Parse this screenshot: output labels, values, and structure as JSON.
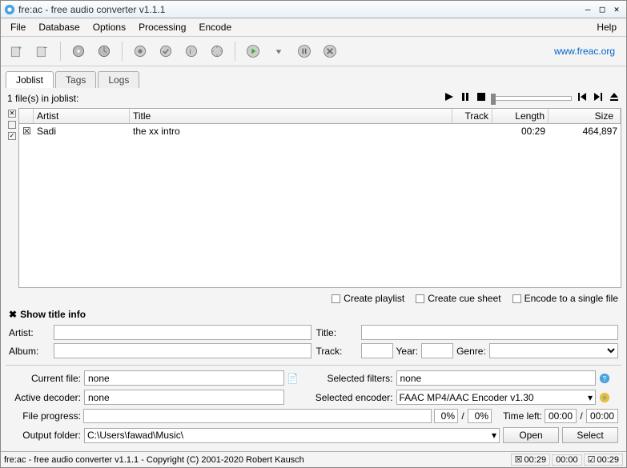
{
  "window": {
    "title": "fre:ac - free audio converter v1.1.1"
  },
  "menu": {
    "file": "File",
    "database": "Database",
    "options": "Options",
    "processing": "Processing",
    "encode": "Encode",
    "help": "Help"
  },
  "website": "www.freac.org",
  "tabs": {
    "joblist": "Joblist",
    "tags": "Tags",
    "logs": "Logs"
  },
  "joblist": {
    "count_label": "1 file(s) in joblist:",
    "columns": {
      "artist": "Artist",
      "title": "Title",
      "track": "Track",
      "length": "Length",
      "size": "Size"
    },
    "rows": [
      {
        "artist": "Sadi",
        "title": "the xx intro",
        "track": "",
        "length": "00:29",
        "size": "464,897"
      }
    ]
  },
  "options": {
    "create_playlist": "Create playlist",
    "create_cuesheet": "Create cue sheet",
    "encode_single": "Encode to a single file"
  },
  "titleinfo": {
    "toggle": "Show title info",
    "artist_lbl": "Artist:",
    "title_lbl": "Title:",
    "album_lbl": "Album:",
    "track_lbl": "Track:",
    "year_lbl": "Year:",
    "genre_lbl": "Genre:"
  },
  "encoder": {
    "current_file_lbl": "Current file:",
    "current_file": "none",
    "selected_filters_lbl": "Selected filters:",
    "selected_filters": "none",
    "active_decoder_lbl": "Active decoder:",
    "active_decoder": "none",
    "selected_encoder_lbl": "Selected encoder:",
    "selected_encoder": "FAAC MP4/AAC Encoder v1.30",
    "file_progress_lbl": "File progress:",
    "pct1": "0%",
    "pct2": "0%",
    "time_left_lbl": "Time left:",
    "time1": "00:00",
    "time2": "00:00",
    "output_folder_lbl": "Output folder:",
    "output_folder": "C:\\Users\\fawad\\Music\\",
    "open_btn": "Open",
    "select_btn": "Select"
  },
  "status": {
    "text": "fre:ac - free audio converter v1.1.1 - Copyright (C) 2001-2020 Robert Kausch",
    "t1": "00:29",
    "t2": "00:00",
    "t3": "00:29"
  }
}
